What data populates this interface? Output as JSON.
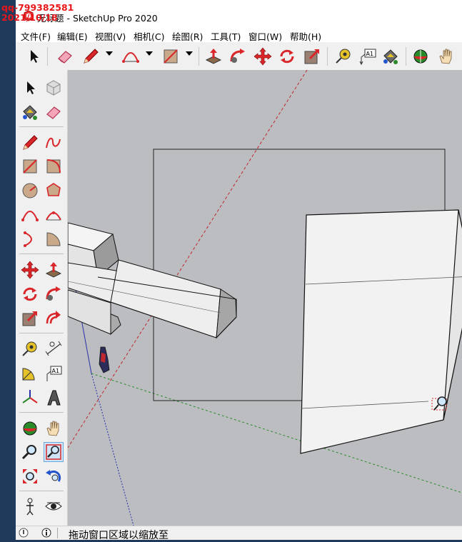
{
  "watermark": {
    "line1": "qq-799382581",
    "line2": "2021/10/18"
  },
  "window": {
    "title": "无标题 - SketchUp Pro 2020"
  },
  "menu": [
    "文件(F)",
    "编辑(E)",
    "视图(V)",
    "相机(C)",
    "绘图(R)",
    "工具(T)",
    "窗口(W)",
    "帮助(H)"
  ],
  "toolbar": {
    "icons": [
      "select-icon",
      "eraser-icon",
      "pencil-line-icon",
      "arc-icon",
      "rectangle-icon",
      "push-pull-icon",
      "follow-me-icon",
      "move-icon",
      "rotate-icon",
      "scale-icon",
      "tape-measure-icon",
      "text-label-icon",
      "paint-bucket-icon",
      "orbit-icon",
      "pan-icon"
    ],
    "text_tool_label": "A1"
  },
  "palette": {
    "text_tool_label": "A1",
    "active_tool": "zoom-window-icon"
  },
  "status": {
    "hint": "拖动窗口区域以缩放至"
  },
  "colors": {
    "accent_red": "#e8161b",
    "tool_red": "#d9262b",
    "viewport": "#bcbdc1",
    "axis_red": "#c0282d",
    "axis_green": "#2a8a2a",
    "axis_blue": "#2630a8"
  }
}
